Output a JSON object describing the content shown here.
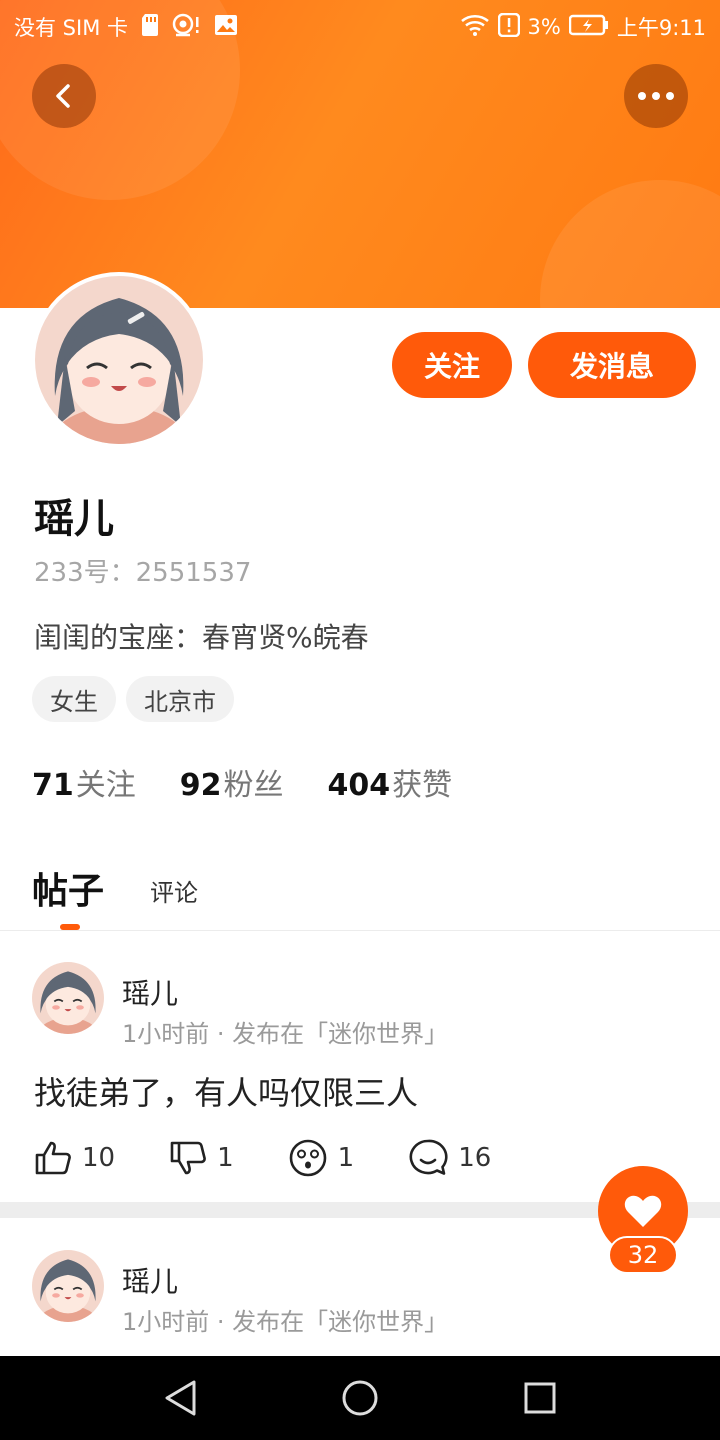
{
  "status_bar": {
    "carrier": "没有 SIM 卡",
    "battery": "3%",
    "time": "上午9:11"
  },
  "header": {
    "back_icon": "chevron-left-icon",
    "more_icon": "more-horizontal-icon"
  },
  "profile": {
    "follow_label": "关注",
    "message_label": "发消息",
    "name": "瑶儿",
    "uid": "233号：2551537",
    "bio": "闺闺的宝座：春宵贤%皖春",
    "tags": [
      "女生",
      "北京市"
    ],
    "stats": [
      {
        "num": "71",
        "label": "关注"
      },
      {
        "num": "92",
        "label": "粉丝"
      },
      {
        "num": "404",
        "label": "获赞"
      }
    ]
  },
  "tabs": [
    {
      "label": "帖子",
      "active": true
    },
    {
      "label": "评论",
      "active": false
    }
  ],
  "posts": [
    {
      "author": "瑶儿",
      "meta": "1小时前 · 发布在「迷你世界」",
      "text": "找徒弟了，有人吗仅限三人",
      "likes": "10",
      "dislikes": "1",
      "surprised": "1",
      "comments": "16"
    },
    {
      "author": "瑶儿",
      "meta": "1小时前 · 发布在「迷你世界」"
    }
  ],
  "like_fab": {
    "count": "32"
  },
  "colors": {
    "accent": "#ff5a0a",
    "banner": "#ff7a12"
  }
}
